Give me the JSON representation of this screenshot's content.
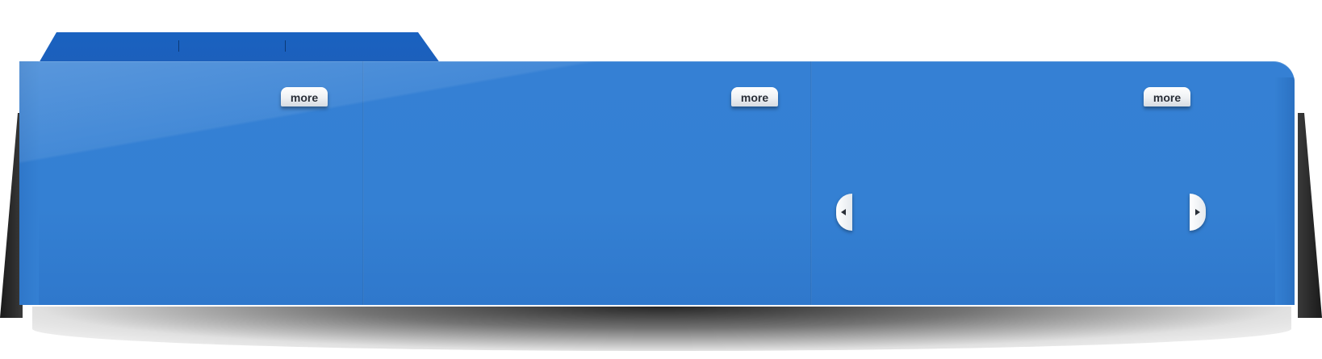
{
  "slider": {
    "more_buttons": [
      {
        "label": "more"
      },
      {
        "label": "more"
      },
      {
        "label": "more"
      }
    ],
    "prev_icon": "chevron-left-icon",
    "next_icon": "chevron-right-icon"
  },
  "colors": {
    "panel_blue": "#3480d3",
    "tab_blue": "#1c5fbb",
    "button_white": "#ffffff",
    "depth_dark": "#1a1a1a"
  }
}
